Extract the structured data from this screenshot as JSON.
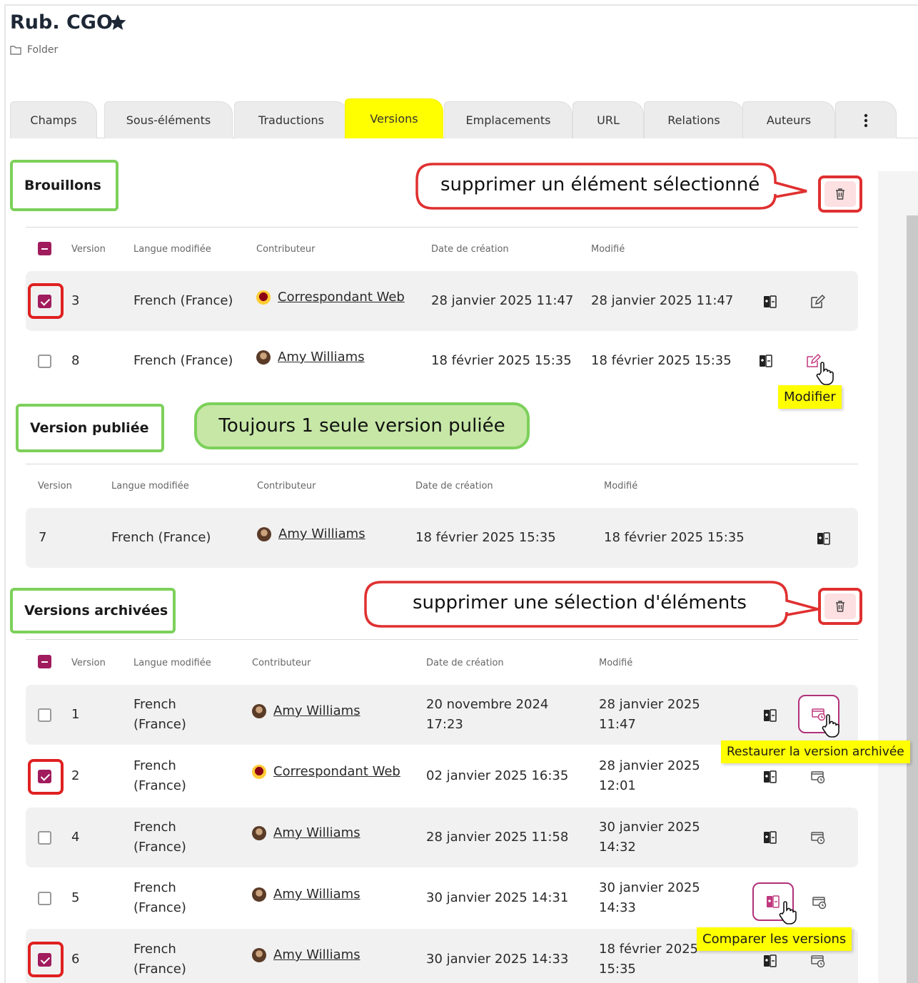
{
  "header": {
    "title": "Rub. CGO",
    "type": "Folder"
  },
  "tabs": [
    {
      "label": "Champs"
    },
    {
      "label": "Sous-éléments"
    },
    {
      "label": "Traductions"
    },
    {
      "label": "Versions"
    },
    {
      "label": "Emplacements"
    },
    {
      "label": "URL"
    },
    {
      "label": "Relations"
    },
    {
      "label": "Auteurs"
    }
  ],
  "annotations": {
    "drafts_heading": "Brouillons",
    "published_heading": "Version publiée",
    "archived_heading": "Versions archivées",
    "one_published": "Toujours 1 seule version puliée",
    "delete_one": "supprimer un élément sélectionné",
    "delete_selection": "supprimer une sélection d'éléments",
    "tooltip_edit": "Modifier",
    "tooltip_restore": "Restaurer la version archivée",
    "tooltip_compare": "Comparer les versions"
  },
  "columns": {
    "version": "Version",
    "language": "Langue modifiée",
    "contributor": "Contributeur",
    "created": "Date de création",
    "modified": "Modifié"
  },
  "drafts": [
    {
      "version": "3",
      "language": "French (France)",
      "contributor": "Correspondant Web",
      "created": "28 janvier 2025 11:47",
      "modified": "28 janvier 2025 11:47",
      "checked": true
    },
    {
      "version": "8",
      "language": "French (France)",
      "contributor": "Amy Williams",
      "created": "18 février 2025 15:35",
      "modified": "18 février 2025 15:35",
      "checked": false
    }
  ],
  "published": [
    {
      "version": "7",
      "language": "French (France)",
      "contributor": "Amy Williams",
      "created": "18 février 2025 15:35",
      "modified": "18 février 2025 15:35"
    }
  ],
  "archived": [
    {
      "version": "1",
      "language_1": "French",
      "language_2": "(France)",
      "contributor": "Amy Williams",
      "created_1": "20 novembre 2024",
      "created_2": "17:23",
      "modified_1": "28 janvier 2025",
      "modified_2": "11:47",
      "checked": false
    },
    {
      "version": "2",
      "language_1": "French",
      "language_2": "(France)",
      "contributor": "Correspondant Web",
      "created_1": "02 janvier 2025 16:35",
      "created_2": "",
      "modified_1": "28 janvier 2025",
      "modified_2": "12:01",
      "checked": true
    },
    {
      "version": "4",
      "language_1": "French",
      "language_2": "(France)",
      "contributor": "Amy Williams",
      "created_1": "28 janvier 2025 11:58",
      "created_2": "",
      "modified_1": "30 janvier 2025",
      "modified_2": "14:32",
      "checked": false
    },
    {
      "version": "5",
      "language_1": "French",
      "language_2": "(France)",
      "contributor": "Amy Williams",
      "created_1": "30 janvier 2025 14:31",
      "created_2": "",
      "modified_1": "30 janvier 2025",
      "modified_2": "14:33",
      "checked": false
    },
    {
      "version": "6",
      "language_1": "French",
      "language_2": "(France)",
      "contributor": "Amy Williams",
      "created_1": "30 janvier 2025 14:33",
      "created_2": "",
      "modified_1": "18 février 2025",
      "modified_2": "15:35",
      "checked": true
    }
  ],
  "icons": {
    "star": "star-icon",
    "folder": "folder-icon",
    "more": "more-vertical-icon",
    "delete": "trash-icon",
    "compare": "compare-icon",
    "edit": "edit-icon",
    "restore": "restore-icon"
  },
  "colors": {
    "accent": "#a01c5d",
    "tab_highlight": "#ffff00",
    "annotation_green": "#7cd05a",
    "annotation_red": "#e03030"
  }
}
